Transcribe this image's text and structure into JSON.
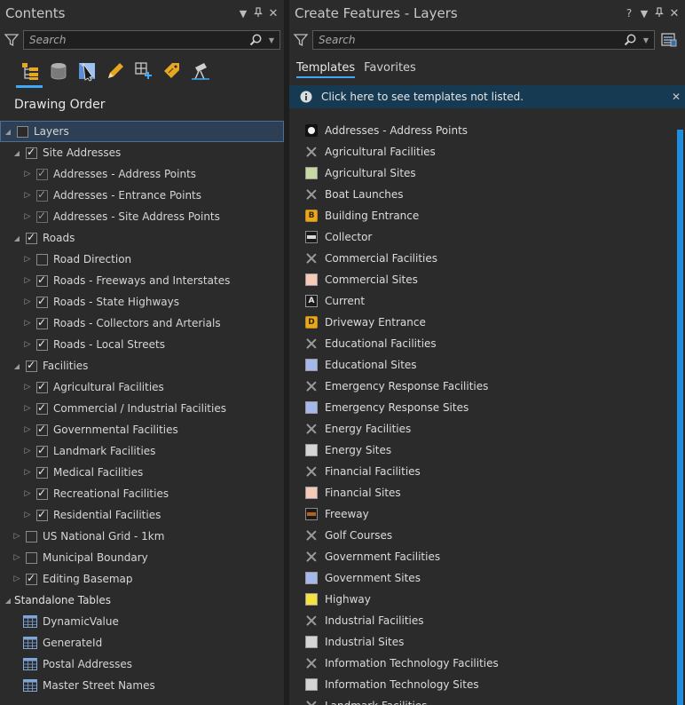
{
  "contents": {
    "title": "Contents",
    "search_placeholder": "Search",
    "tools": [
      "list-by-drawing-order-icon",
      "list-by-source-icon",
      "list-by-selection-icon",
      "list-by-editing-icon",
      "list-by-snapping-icon",
      "list-by-labeling-icon",
      "list-by-perspective-icon"
    ],
    "section_title": "Drawing Order",
    "tree": [
      {
        "label": "Layers",
        "level": 0,
        "expanded": true,
        "checkbox": true,
        "checked": false,
        "selected": true
      },
      {
        "label": "Site Addresses",
        "level": 1,
        "expanded": true,
        "checkbox": true,
        "checked": true
      },
      {
        "label": "Addresses - Address Points",
        "level": 2,
        "expanded": false,
        "checkbox": true,
        "checked": true,
        "dim": true
      },
      {
        "label": "Addresses - Entrance Points",
        "level": 2,
        "expanded": false,
        "checkbox": true,
        "checked": true,
        "dim": true
      },
      {
        "label": "Addresses - Site Address Points",
        "level": 2,
        "expanded": false,
        "checkbox": true,
        "checked": true,
        "dim": true
      },
      {
        "label": "Roads",
        "level": 1,
        "expanded": true,
        "checkbox": true,
        "checked": true
      },
      {
        "label": "Road Direction",
        "level": 2,
        "expanded": false,
        "checkbox": true,
        "checked": false
      },
      {
        "label": "Roads - Freeways and Interstates",
        "level": 2,
        "expanded": false,
        "checkbox": true,
        "checked": true
      },
      {
        "label": "Roads - State Highways",
        "level": 2,
        "expanded": false,
        "checkbox": true,
        "checked": true
      },
      {
        "label": "Roads - Collectors and Arterials",
        "level": 2,
        "expanded": false,
        "checkbox": true,
        "checked": true
      },
      {
        "label": "Roads - Local Streets",
        "level": 2,
        "expanded": false,
        "checkbox": true,
        "checked": true
      },
      {
        "label": "Facilities",
        "level": 1,
        "expanded": true,
        "checkbox": true,
        "checked": true
      },
      {
        "label": "Agricultural Facilities",
        "level": 2,
        "expanded": false,
        "checkbox": true,
        "checked": true
      },
      {
        "label": "Commercial / Industrial Facilities",
        "level": 2,
        "expanded": false,
        "checkbox": true,
        "checked": true
      },
      {
        "label": "Governmental Facilities",
        "level": 2,
        "expanded": false,
        "checkbox": true,
        "checked": true
      },
      {
        "label": "Landmark Facilities",
        "level": 2,
        "expanded": false,
        "checkbox": true,
        "checked": true
      },
      {
        "label": "Medical Facilities",
        "level": 2,
        "expanded": false,
        "checkbox": true,
        "checked": true
      },
      {
        "label": "Recreational Facilities",
        "level": 2,
        "expanded": false,
        "checkbox": true,
        "checked": true
      },
      {
        "label": "Residential Facilities",
        "level": 2,
        "expanded": false,
        "checkbox": true,
        "checked": true
      },
      {
        "label": "US National Grid - 1km",
        "level": 1,
        "expanded": false,
        "checkbox": true,
        "checked": false
      },
      {
        "label": "Municipal Boundary",
        "level": 1,
        "expanded": false,
        "checkbox": true,
        "checked": false
      },
      {
        "label": "Editing Basemap",
        "level": 1,
        "expanded": false,
        "checkbox": true,
        "checked": true
      },
      {
        "label": "Standalone Tables",
        "level": 0,
        "expanded": true,
        "checkbox": false,
        "header": true
      },
      {
        "label": "DynamicValue",
        "level": 1,
        "table": true
      },
      {
        "label": "GenerateId",
        "level": 1,
        "table": true
      },
      {
        "label": "Postal Addresses",
        "level": 1,
        "table": true
      },
      {
        "label": "Master Street Names",
        "level": 1,
        "table": true
      }
    ]
  },
  "create_features": {
    "title": "Create Features - Layers",
    "help": "?",
    "search_placeholder": "Search",
    "tabs": [
      {
        "label": "Templates",
        "active": true
      },
      {
        "label": "Favorites",
        "active": false
      }
    ],
    "info_message": "Click here to see templates not listed.",
    "templates": [
      {
        "label": "Addresses - Address Points",
        "sym": "dot"
      },
      {
        "label": "Agricultural Facilities",
        "sym": "x"
      },
      {
        "label": "Agricultural Sites",
        "sym": "poly",
        "color": "#c5d9a0"
      },
      {
        "label": "Boat Launches",
        "sym": "x"
      },
      {
        "label": "Building Entrance",
        "sym": "badge",
        "text": "B"
      },
      {
        "label": "Collector",
        "sym": "line",
        "color": "#d9d9d9"
      },
      {
        "label": "Commercial Facilities",
        "sym": "x"
      },
      {
        "label": "Commercial Sites",
        "sym": "poly",
        "color": "#f7c9b8"
      },
      {
        "label": "Current",
        "sym": "badge-dark",
        "text": "A"
      },
      {
        "label": "Driveway Entrance",
        "sym": "badge",
        "text": "D"
      },
      {
        "label": "Educational Facilities",
        "sym": "x"
      },
      {
        "label": "Educational Sites",
        "sym": "poly",
        "color": "#a5b8ec"
      },
      {
        "label": "Emergency Response Facilities",
        "sym": "x"
      },
      {
        "label": "Emergency Response Sites",
        "sym": "poly",
        "color": "#a5b8ec"
      },
      {
        "label": "Energy Facilities",
        "sym": "x"
      },
      {
        "label": "Energy Sites",
        "sym": "poly",
        "color": "#d4d4d4"
      },
      {
        "label": "Financial Facilities",
        "sym": "x"
      },
      {
        "label": "Financial Sites",
        "sym": "poly",
        "color": "#f7c9b8"
      },
      {
        "label": "Freeway",
        "sym": "line",
        "color": "#b5611c"
      },
      {
        "label": "Golf Courses",
        "sym": "x"
      },
      {
        "label": "Government Facilities",
        "sym": "x"
      },
      {
        "label": "Government Sites",
        "sym": "poly",
        "color": "#a5b8ec"
      },
      {
        "label": "Highway",
        "sym": "poly",
        "color": "#f6e23c"
      },
      {
        "label": "Industrial Facilities",
        "sym": "x"
      },
      {
        "label": "Industrial Sites",
        "sym": "poly",
        "color": "#d4d4d4"
      },
      {
        "label": "Information Technology Facilities",
        "sym": "x"
      },
      {
        "label": "Information Technology Sites",
        "sym": "poly",
        "color": "#d4d4d4"
      },
      {
        "label": "Landmark Facilities",
        "sym": "x"
      }
    ]
  },
  "colors": {
    "accent": "#3fa9f5",
    "panel_bg": "#2b2b2b",
    "info_bg": "#163a52",
    "scrollbar": "#1e8fe0"
  }
}
